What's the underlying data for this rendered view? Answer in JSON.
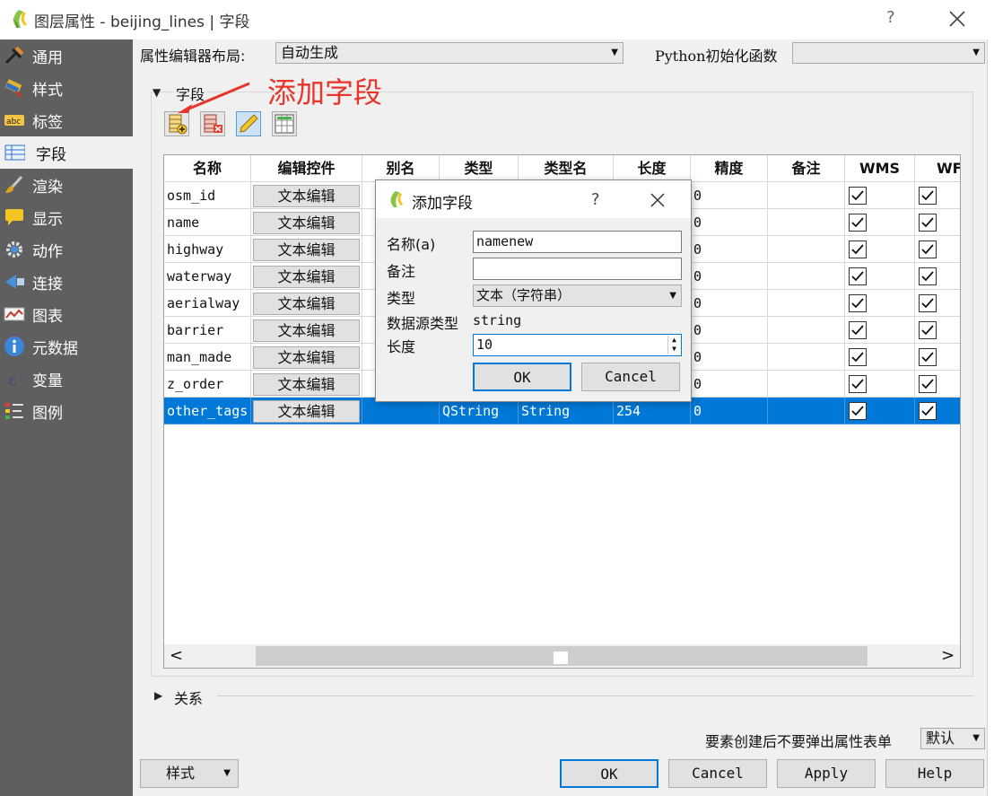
{
  "window": {
    "title": "图层属性 - beijing_lines | 字段",
    "help": "?"
  },
  "sidebar": {
    "items": [
      {
        "label": "通用"
      },
      {
        "label": "样式"
      },
      {
        "label": "标签"
      },
      {
        "label": "字段"
      },
      {
        "label": "渲染"
      },
      {
        "label": "显示"
      },
      {
        "label": "动作"
      },
      {
        "label": "连接"
      },
      {
        "label": "图表"
      },
      {
        "label": "元数据"
      },
      {
        "label": "变量"
      },
      {
        "label": "图例"
      }
    ],
    "active_index": 3
  },
  "topbar": {
    "layout_label": "属性编辑器布局:",
    "layout_value": "自动生成",
    "python_label": "Python初始化函数",
    "python_value": ""
  },
  "fields_group": {
    "title": "字段"
  },
  "annotation": "添加字段",
  "table": {
    "headers": [
      "名称",
      "编辑控件",
      "别名",
      "类型",
      "类型名",
      "长度",
      "精度",
      "备注",
      "WMS",
      "WFS"
    ],
    "rows": [
      {
        "name": "osm_id",
        "widget": "文本编辑",
        "alias": "",
        "type": "",
        "typename": "",
        "length": "",
        "precision": "0",
        "comment": "",
        "wms": true,
        "wfs": true
      },
      {
        "name": "name",
        "widget": "文本编辑",
        "alias": "",
        "type": "",
        "typename": "",
        "length": "",
        "precision": "0",
        "comment": "",
        "wms": true,
        "wfs": true
      },
      {
        "name": "highway",
        "widget": "文本编辑",
        "alias": "",
        "type": "",
        "typename": "",
        "length": "",
        "precision": "0",
        "comment": "",
        "wms": true,
        "wfs": true
      },
      {
        "name": "waterway",
        "widget": "文本编辑",
        "alias": "",
        "type": "",
        "typename": "",
        "length": "",
        "precision": "0",
        "comment": "",
        "wms": true,
        "wfs": true
      },
      {
        "name": "aerialway",
        "widget": "文本编辑",
        "alias": "",
        "type": "",
        "typename": "",
        "length": "",
        "precision": "0",
        "comment": "",
        "wms": true,
        "wfs": true
      },
      {
        "name": "barrier",
        "widget": "文本编辑",
        "alias": "",
        "type": "",
        "typename": "",
        "length": "",
        "precision": "0",
        "comment": "",
        "wms": true,
        "wfs": true
      },
      {
        "name": "man_made",
        "widget": "文本编辑",
        "alias": "",
        "type": "",
        "typename": "",
        "length": "",
        "precision": "0",
        "comment": "",
        "wms": true,
        "wfs": true
      },
      {
        "name": "z_order",
        "widget": "文本编辑",
        "alias": "",
        "type": "",
        "typename": "",
        "length": "",
        "precision": "0",
        "comment": "",
        "wms": true,
        "wfs": true
      },
      {
        "name": "other_tags",
        "widget": "文本编辑",
        "alias": "",
        "type": "QString",
        "typename": "String",
        "length": "254",
        "precision": "0",
        "comment": "",
        "wms": true,
        "wfs": true,
        "selected": true
      }
    ]
  },
  "relations_group": {
    "title": "关系"
  },
  "bottom": {
    "suppress_label": "要素创建后不要弹出属性表单",
    "suppress_value": "默认",
    "style_button": "样式",
    "ok": "OK",
    "cancel": "Cancel",
    "apply": "Apply",
    "help": "Help"
  },
  "dialog": {
    "title": "添加字段",
    "help": "?",
    "name_label": "名称(a)",
    "name_value": "namenew",
    "comment_label": "备注",
    "comment_value": "",
    "type_label": "类型",
    "type_value": "文本（字符串）",
    "provider_type_label": "数据源类型",
    "provider_type_value": "string",
    "length_label": "长度",
    "length_value": "10",
    "ok": "OK",
    "cancel": "Cancel"
  },
  "colors": {
    "accent": "#0078d7",
    "sidebar_bg": "#5f5f5f",
    "annotation": "#e8342a"
  }
}
